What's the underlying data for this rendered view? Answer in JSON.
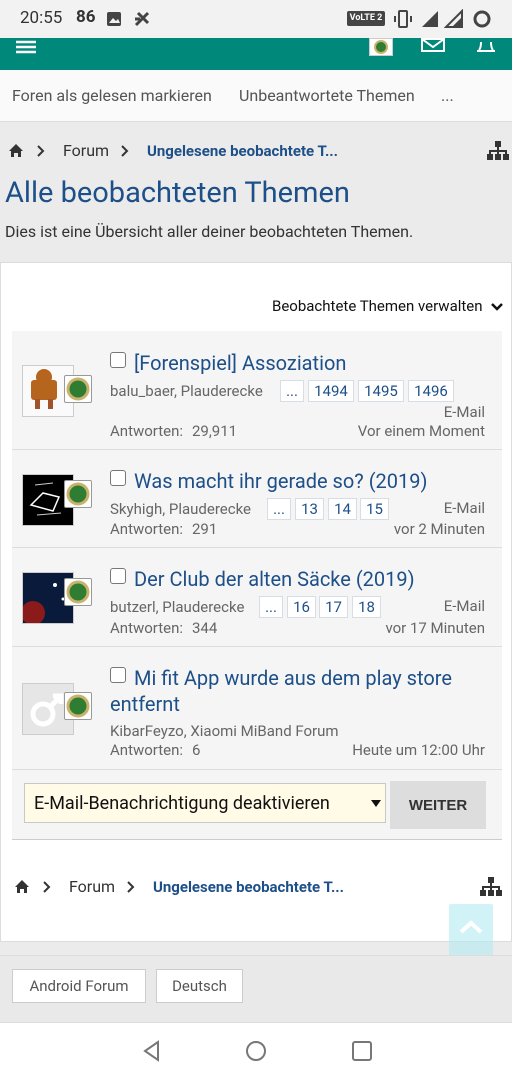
{
  "status": {
    "time": "20:55",
    "number": "86",
    "volte": "VoLTE 2",
    "net": "4G"
  },
  "tabs": [
    "Foren als gelesen markieren",
    "Unbeantwortete Themen",
    "..."
  ],
  "breadcrumb": {
    "forum": "Forum",
    "current": "Ungelesene beobachtete T..."
  },
  "page": {
    "title": "Alle beobachteten Themen",
    "description": "Dies ist eine Übersicht aller deiner beobachteten Themen."
  },
  "manage_label": "Beobachtete Themen verwalten",
  "threads": [
    {
      "title": "[Forenspiel] Assoziation",
      "meta": "balu_baer, Plauderecke",
      "pages": [
        "...",
        "1494",
        "1495",
        "1496"
      ],
      "notify": "E-Mail",
      "replies_label": "Antworten:",
      "replies": "29,911",
      "time": "Vor einem Moment"
    },
    {
      "title": "Was macht ihr gerade so? (2019)",
      "meta": "Skyhigh, Plauderecke",
      "pages": [
        "...",
        "13",
        "14",
        "15"
      ],
      "notify": "E-Mail",
      "replies_label": "Antworten:",
      "replies": "291",
      "time": "vor 2 Minuten"
    },
    {
      "title": "Der Club der alten Säcke (2019)",
      "meta": "butzerl, Plauderecke",
      "pages": [
        "...",
        "16",
        "17",
        "18"
      ],
      "notify": "E-Mail",
      "replies_label": "Antworten:",
      "replies": "344",
      "time": "vor 17 Minuten"
    },
    {
      "title": "Mi fit App wurde aus dem play store entfernt",
      "meta": "KibarFeyzo, Xiaomi MiBand Forum",
      "pages": [],
      "notify": "",
      "replies_label": "Antworten:",
      "replies": "6",
      "time": "Heute um 12:00 Uhr"
    }
  ],
  "action": {
    "select_value": "E-Mail-Benachrichtigung deaktivieren",
    "button": "WEITER"
  },
  "footer": {
    "forum_link": "Android Forum",
    "language": "Deutsch"
  },
  "colors": {
    "accent": "#00897b",
    "link": "#1d4f88"
  }
}
